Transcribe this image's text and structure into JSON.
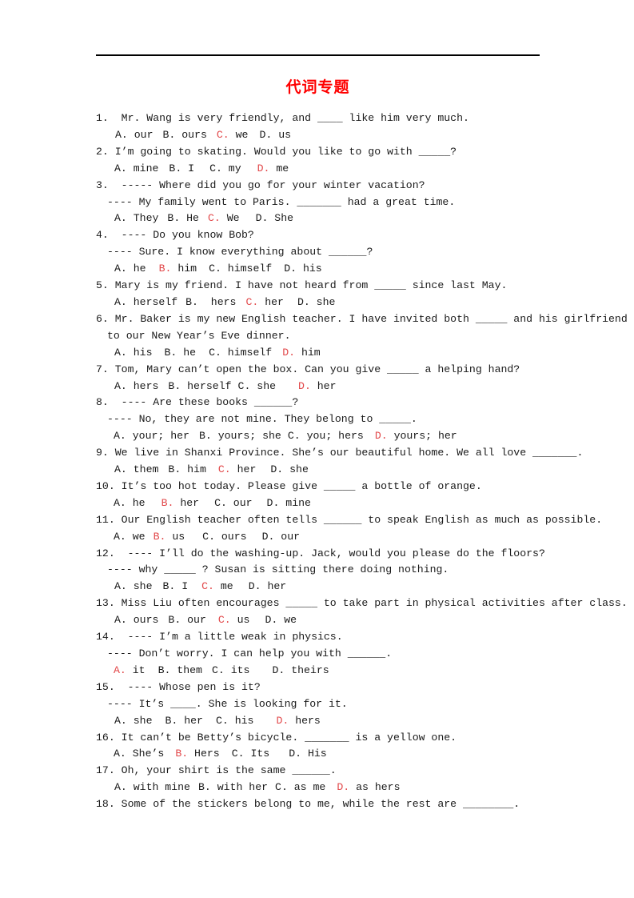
{
  "document": {
    "title": "代词专题",
    "title_color": "#ff0000",
    "answer_color": "#e2484a",
    "body_color": "#1a1a1a"
  },
  "questions": [
    {
      "lines": [
        "1.  Mr. Wang is very friendly, and ____ like him very much."
      ],
      "options": [
        {
          "mark": "A.",
          "text": " our",
          "pad": 10,
          "answer": false
        },
        {
          "mark": "B.",
          "text": " ours",
          "pad": 12,
          "answer": false
        },
        {
          "mark": "C.",
          "text": " we",
          "pad": 12,
          "answer": true
        },
        {
          "mark": "D.",
          "text": " us",
          "pad": 14,
          "answer": false
        }
      ]
    },
    {
      "lines": [
        "2. I’m going to skating. Would you like to go with _____?"
      ],
      "options": [
        {
          "mark": "A.",
          "text": " mine",
          "pad": 9,
          "answer": false
        },
        {
          "mark": "B.",
          "text": " I",
          "pad": 13,
          "answer": false
        },
        {
          "mark": "C.",
          "text": " my",
          "pad": 19,
          "answer": false
        },
        {
          "mark": "D.",
          "text": " me",
          "pad": 20,
          "answer": true
        }
      ]
    },
    {
      "lines": [
        "3.  ----- Where did you go for your winter vacation?",
        "---- My family went to Paris. _______ had a great time."
      ],
      "options": [
        {
          "mark": "A.",
          "text": " They",
          "pad": 9,
          "answer": false
        },
        {
          "mark": "B.",
          "text": " He",
          "pad": 11,
          "answer": false
        },
        {
          "mark": "C.",
          "text": " We",
          "pad": 11,
          "answer": true
        },
        {
          "mark": "D.",
          "text": " She",
          "pad": 20,
          "answer": false
        }
      ]
    },
    {
      "lines": [
        "4.  ---- Do you know Bob?",
        "---- Sure. I know everything about ______?"
      ],
      "options": [
        {
          "mark": "A.",
          "text": " he",
          "pad": 9,
          "answer": false
        },
        {
          "mark": "B.",
          "text": " him",
          "pad": 16,
          "answer": true
        },
        {
          "mark": "C.",
          "text": " himself",
          "pad": 15,
          "answer": false
        },
        {
          "mark": "D.",
          "text": " his",
          "pad": 15,
          "answer": false
        }
      ]
    },
    {
      "lines": [
        "5. Mary is my friend. I have not heard from _____ since last May."
      ],
      "options": [
        {
          "mark": "A.",
          "text": " herself",
          "pad": 9,
          "answer": false
        },
        {
          "mark": "B.",
          "text": "  hers",
          "pad": 10,
          "answer": false
        },
        {
          "mark": "C.",
          "text": " her",
          "pad": 12,
          "answer": true
        },
        {
          "mark": "D.",
          "text": " she",
          "pad": 17,
          "answer": false
        }
      ]
    },
    {
      "lines": [
        "6. Mr. Baker is my new English teacher. I have invited both _____ and his girlfriend",
        "to our New Year’s Eve dinner."
      ],
      "options": [
        {
          "mark": "A.",
          "text": " his",
          "pad": 9,
          "answer": false
        },
        {
          "mark": "B.",
          "text": " he",
          "pad": 15,
          "answer": false
        },
        {
          "mark": "C.",
          "text": " himself",
          "pad": 16,
          "answer": false
        },
        {
          "mark": "D.",
          "text": " him",
          "pad": 13,
          "answer": true
        }
      ]
    },
    {
      "lines": [
        "7. Tom, Mary can’t open the box. Can you give _____ a helping hand?"
      ],
      "options": [
        {
          "mark": "A.",
          "text": " hers",
          "pad": 9,
          "answer": false
        },
        {
          "mark": "B.",
          "text": " herself",
          "pad": 12,
          "answer": false
        },
        {
          "mark": "C.",
          "text": " she",
          "pad": 8,
          "answer": false
        },
        {
          "mark": "D.",
          "text": " her",
          "pad": 28,
          "answer": true
        }
      ]
    },
    {
      "lines": [
        "8.  ---- Are these books ______?",
        "---- No, they are not mine. They belong to _____."
      ],
      "options": [
        {
          "mark": "A.",
          "text": " your; her",
          "pad": 8,
          "answer": false
        },
        {
          "mark": "B.",
          "text": " yours; she",
          "pad": 12,
          "answer": false
        },
        {
          "mark": "C.",
          "text": " you; hers",
          "pad": 8,
          "answer": false
        },
        {
          "mark": "D.",
          "text": " yours; her",
          "pad": 14,
          "answer": true
        }
      ]
    },
    {
      "lines": [
        "9. We live in Shanxi Province. She’s our beautiful home. We all love _______."
      ],
      "options": [
        {
          "mark": "A.",
          "text": " them",
          "pad": 9,
          "answer": false
        },
        {
          "mark": "B.",
          "text": " him",
          "pad": 12,
          "answer": false
        },
        {
          "mark": "C.",
          "text": " her",
          "pad": 15,
          "answer": true
        },
        {
          "mark": "D.",
          "text": " she",
          "pad": 18,
          "answer": false
        }
      ]
    },
    {
      "lines": [
        "10. It’s too hot today. Please give _____ a bottle of orange."
      ],
      "options": [
        {
          "mark": "A.",
          "text": " he",
          "pad": 8,
          "answer": false
        },
        {
          "mark": "B.",
          "text": " her",
          "pad": 20,
          "answer": true
        },
        {
          "mark": "C.",
          "text": " our",
          "pad": 19,
          "answer": false
        },
        {
          "mark": "D.",
          "text": " mine",
          "pad": 18,
          "answer": false
        }
      ]
    },
    {
      "lines": [
        "11. Our English teacher often tells ______ to speak English as much as possible."
      ],
      "options": [
        {
          "mark": "A.",
          "text": " we",
          "pad": 8,
          "answer": false
        },
        {
          "mark": "B.",
          "text": " us",
          "pad": 10,
          "answer": true
        },
        {
          "mark": "C.",
          "text": " ours",
          "pad": 22,
          "answer": false
        },
        {
          "mark": "D.",
          "text": " our",
          "pad": 19,
          "answer": false
        }
      ]
    },
    {
      "lines": [
        "12.  ---- I’ll do the washing-up. Jack, would you please do the floors?",
        "---- why _____ ? Susan is sitting there doing nothing."
      ],
      "options": [
        {
          "mark": "A.",
          "text": " she",
          "pad": 9,
          "answer": false
        },
        {
          "mark": "B.",
          "text": " I",
          "pad": 13,
          "answer": false
        },
        {
          "mark": "C.",
          "text": " me",
          "pad": 17,
          "answer": true
        },
        {
          "mark": "D.",
          "text": " her",
          "pad": 19,
          "answer": false
        }
      ]
    },
    {
      "lines": [
        "13. Miss Liu often encourages _____ to take part in physical activities after class."
      ],
      "options": [
        {
          "mark": "A.",
          "text": " ours",
          "pad": 9,
          "answer": false
        },
        {
          "mark": "B.",
          "text": " our",
          "pad": 12,
          "answer": false
        },
        {
          "mark": "C.",
          "text": " us",
          "pad": 15,
          "answer": true
        },
        {
          "mark": "D.",
          "text": " we",
          "pad": 19,
          "answer": false
        }
      ]
    },
    {
      "lines": [
        "14.  ---- I’m a little weak in physics.",
        "---- Don’t worry. I can help you with ______."
      ],
      "options": [
        {
          "mark": "A.",
          "text": " it",
          "pad": 8,
          "answer": true
        },
        {
          "mark": "B.",
          "text": " them",
          "pad": 16,
          "answer": false
        },
        {
          "mark": "C.",
          "text": " its",
          "pad": 12,
          "answer": false
        },
        {
          "mark": "D.",
          "text": " theirs",
          "pad": 28,
          "answer": false
        }
      ]
    },
    {
      "lines": [
        "15.  ---- Whose pen is it?",
        "---- It’s ____. She is looking for it."
      ],
      "options": [
        {
          "mark": "A.",
          "text": " she",
          "pad": 9,
          "answer": false
        },
        {
          "mark": "B.",
          "text": " her",
          "pad": 16,
          "answer": false
        },
        {
          "mark": "C.",
          "text": " his",
          "pad": 16,
          "answer": false
        },
        {
          "mark": "D.",
          "text": " hers",
          "pad": 28,
          "answer": true
        }
      ]
    },
    {
      "lines": [
        "16. It can’t be Betty’s bicycle. _______ is a yellow one."
      ],
      "options": [
        {
          "mark": "A.",
          "text": " She’s",
          "pad": 8,
          "answer": false
        },
        {
          "mark": "B.",
          "text": " Hers",
          "pad": 14,
          "answer": true
        },
        {
          "mark": "C.",
          "text": " Its",
          "pad": 15,
          "answer": false
        },
        {
          "mark": "D.",
          "text": " His",
          "pad": 24,
          "answer": false
        }
      ]
    },
    {
      "lines": [
        "17. Oh, your shirt is the same ______."
      ],
      "options": [
        {
          "mark": "A.",
          "text": " with mine",
          "pad": 9,
          "answer": false
        },
        {
          "mark": "B.",
          "text": " with her",
          "pad": 10,
          "answer": false
        },
        {
          "mark": "C.",
          "text": " as me",
          "pad": 9,
          "answer": false
        },
        {
          "mark": "D.",
          "text": " as hers",
          "pad": 14,
          "answer": true
        }
      ]
    },
    {
      "lines": [
        "18. Some of the stickers belong to me, while the rest are ________."
      ],
      "options": []
    }
  ]
}
